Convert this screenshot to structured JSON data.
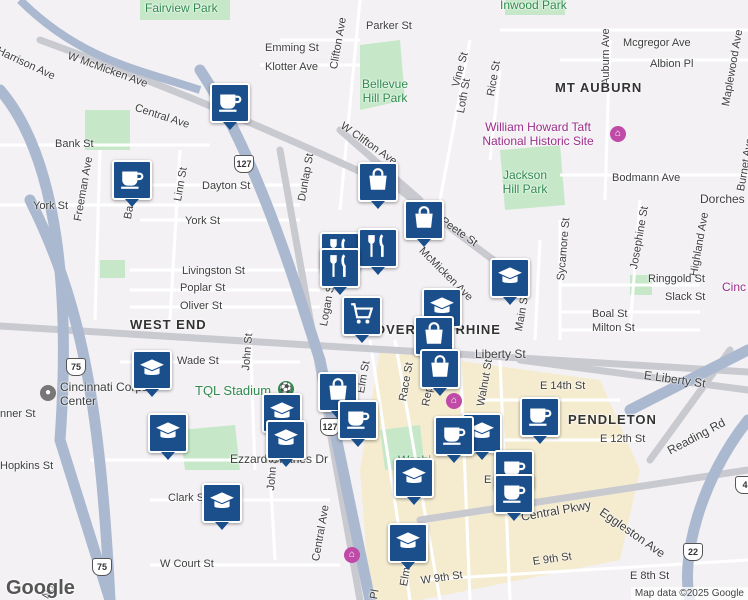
{
  "map": {
    "labels": {
      "fairview_park": "Fairview Park",
      "inwood_park": "Inwood Park",
      "parker_st": "Parker St",
      "mcgregor_ave": "Mcgregor Ave",
      "auburn_ave": "Auburn Ave",
      "albion_pl": "Albion Pl",
      "emming_st": "Emming St",
      "klotter_ave": "Klotter Ave",
      "clifton_ave_n": "Clifton Ave",
      "bellevue_park": "Bellevue Hill Park",
      "vine_st": "Vine St",
      "loth_st": "Loth St",
      "rice_st": "Rice St",
      "mt_auburn": "MT AUBURN",
      "w_mcmicken_ave": "W McMicken Ave",
      "harrison_ave": "Harrison Ave",
      "central_ave_n": "Central Ave",
      "w_clifton_ave": "W Clifton Ave",
      "taft_site": "William Howard Taft National Historic Site",
      "maplewood_ave": "Maplewood Ave",
      "bank_st": "Bank St",
      "bodmann_ave": "Bodmann Ave",
      "burnet_ave": "Burnet Ave",
      "dorchester": "Dorches",
      "jackson_hill_park": "Jackson Hill Park",
      "freeman_ave": "Freeman Ave",
      "linn_st": "Linn St",
      "dayton_st": "Dayton St",
      "dunlap_st": "Dunlap St",
      "york_st_w": "York St",
      "york_st": "York St",
      "ba": "Ba",
      "peete_st": "Peete St",
      "sycamore_st": "Sycamore St",
      "josephine_st": "Josephine St",
      "highland_ave": "Highland Ave",
      "livingston_st": "Livingston St",
      "poplar_st": "Poplar St",
      "oliver_st": "Oliver St",
      "logan_st": "Logan St",
      "ringgold_st": "Ringgold St",
      "slack_st": "Slack St",
      "cinc": "Cinc",
      "mcmicken_ave": "McMicken Ave",
      "main_st": "Main St",
      "boal_st": "Boal St",
      "milton_st": "Milton St",
      "west_end": "WEST END",
      "over_the_rhine": "OVER-THE-RHINE",
      "liberty_st": "Liberty St",
      "e_liberty_st": "E Liberty St",
      "wade_st": "Wade St",
      "john_st": "John St",
      "race_st": "Race St",
      "elm_st": "Elm St",
      "republic_st": "Republic St",
      "walnut_st": "Walnut St",
      "cincinnati_corps": "Cincinnati Corps Center",
      "tql_stadium": "TQL Stadium",
      "e_14th_st": "E 14th St",
      "pendleton": "PENDLETON",
      "reading_rd": "Reading Rd",
      "e_12th_st": "E 12th St",
      "ezzard_charles": "Ezzard Charles Dr",
      "john_st_s": "John St",
      "central_ave_s": "Central Ave",
      "hopkins_st": "Hopkins St",
      "conner_st": "nner St",
      "washington": "Washi",
      "e_small": "E",
      "eggleston_ave": "Eggleston Ave",
      "central_pkwy": "Central Pkwy",
      "clark_st": "Clark St",
      "w_court_st": "W Court St",
      "w_9th_st": "W 9th St",
      "e_9th_st": "E 9th St",
      "e_8th_st": "E 8th St",
      "elm_s": "Elm",
      "pl": "Pl",
      "no": "No"
    },
    "shields": {
      "us127_a": "127",
      "us127_b": "127",
      "i75_a": "75",
      "i75_b": "75",
      "us22": "22",
      "i471": "4"
    },
    "markers": [
      {
        "type": "coffee",
        "icon": "coffee-cup-icon"
      },
      {
        "type": "coffee",
        "icon": "coffee-cup-icon"
      },
      {
        "type": "shopping",
        "icon": "shopping-bag-icon"
      },
      {
        "type": "shopping",
        "icon": "shopping-bag-icon"
      },
      {
        "type": "restaurant",
        "icon": "fork-knife-icon"
      },
      {
        "type": "restaurant",
        "icon": "fork-knife-icon"
      },
      {
        "type": "restaurant",
        "icon": "fork-knife-icon"
      },
      {
        "type": "school",
        "icon": "graduation-cap-icon"
      },
      {
        "type": "school",
        "icon": "graduation-cap-icon"
      },
      {
        "type": "grocery",
        "icon": "shopping-cart-icon"
      },
      {
        "type": "shopping",
        "icon": "shopping-bag-icon"
      },
      {
        "type": "shopping",
        "icon": "shopping-bag-icon"
      },
      {
        "type": "school",
        "icon": "graduation-cap-icon"
      },
      {
        "type": "shopping",
        "icon": "shopping-bag-icon"
      },
      {
        "type": "coffee",
        "icon": "coffee-cup-icon"
      },
      {
        "type": "school",
        "icon": "graduation-cap-icon"
      },
      {
        "type": "school",
        "icon": "graduation-cap-icon"
      },
      {
        "type": "school",
        "icon": "graduation-cap-icon"
      },
      {
        "type": "coffee",
        "icon": "coffee-cup-icon"
      },
      {
        "type": "school",
        "icon": "graduation-cap-icon"
      },
      {
        "type": "coffee",
        "icon": "coffee-cup-icon"
      },
      {
        "type": "coffee",
        "icon": "coffee-cup-icon"
      },
      {
        "type": "coffee",
        "icon": "coffee-cup-icon"
      },
      {
        "type": "school",
        "icon": "graduation-cap-icon"
      },
      {
        "type": "school",
        "icon": "graduation-cap-icon"
      },
      {
        "type": "school",
        "icon": "graduation-cap-icon"
      }
    ],
    "logo": "Google",
    "attribution": "Map data ©2025 Google",
    "colors": {
      "background": "#f3f1f4",
      "park": "#c6e8c9",
      "highway": "#aab9d0",
      "downtown": "#f5ecd0",
      "marker": "#1a4f8b"
    }
  }
}
